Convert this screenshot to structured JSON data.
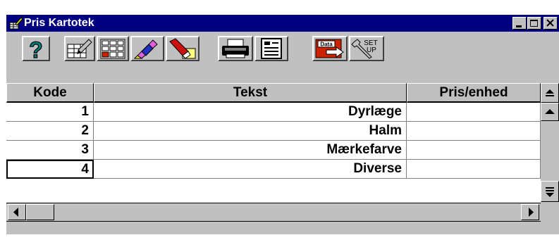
{
  "window": {
    "title": "Pris Kartotek",
    "controls": [
      "minimize-icon",
      "maximize-icon",
      "close-icon"
    ]
  },
  "toolbar": {
    "buttons": [
      {
        "name": "help-button",
        "icon": "question-mark-icon"
      },
      {
        "name": "edit-button",
        "icon": "table-pen-icon"
      },
      {
        "name": "calendar-button",
        "icon": "calendar-grid-icon"
      },
      {
        "name": "highlight-button",
        "icon": "highlighter-icon"
      },
      {
        "name": "eraser-button",
        "icon": "eraser-icon"
      },
      {
        "name": "print-button",
        "icon": "printer-icon"
      },
      {
        "name": "view-button",
        "icon": "document-view-icon"
      },
      {
        "name": "data-export-button",
        "icon": "data-export-icon",
        "label": "Data"
      },
      {
        "name": "setup-button",
        "icon": "setup-wrench-icon",
        "label": "SET UP"
      }
    ]
  },
  "table": {
    "columns": [
      "Kode",
      "Tekst",
      "Pris/enhed"
    ],
    "rows": [
      {
        "kode": "1",
        "tekst": "Dyrlæge",
        "pris": ""
      },
      {
        "kode": "2",
        "tekst": "Halm",
        "pris": ""
      },
      {
        "kode": "3",
        "tekst": "Mærkefarve",
        "pris": ""
      },
      {
        "kode": "4",
        "tekst": "Diverse",
        "pris": ""
      }
    ],
    "selected_row": 4
  },
  "colors": {
    "titlebar": "#000080",
    "face": "#c0c0c0",
    "help_icon": "#008080",
    "export_icon": "#cc2200"
  }
}
